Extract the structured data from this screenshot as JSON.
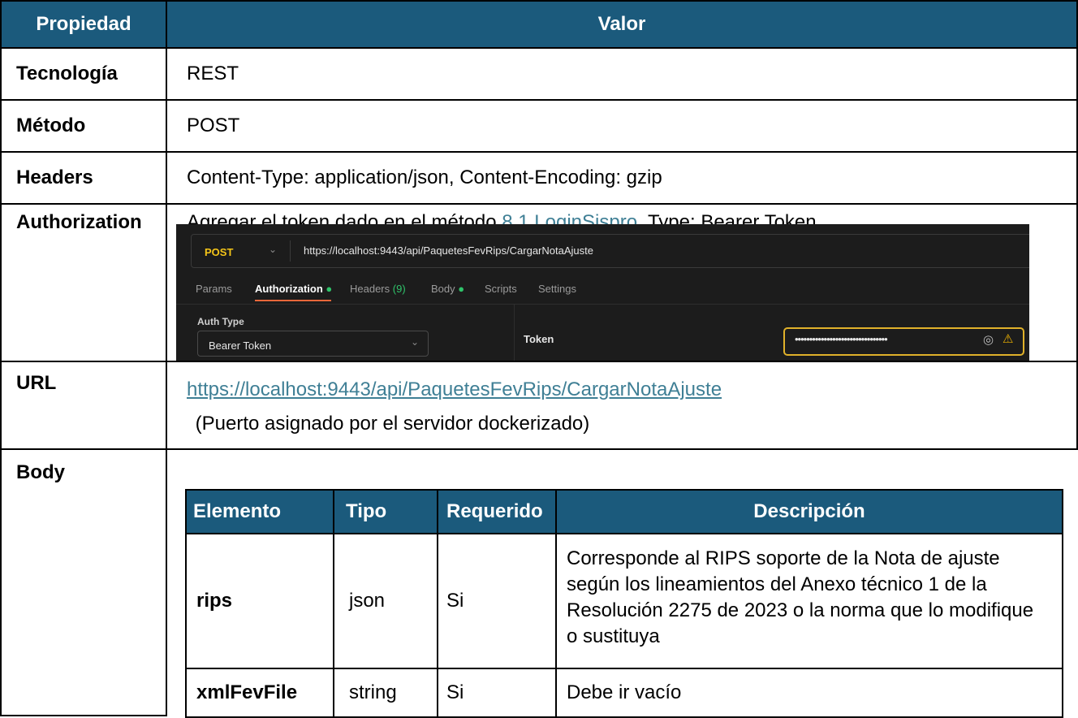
{
  "main_table": {
    "headers": {
      "property": "Propiedad",
      "value": "Valor"
    },
    "rows": {
      "technology": {
        "key": "Tecnología",
        "value": "REST"
      },
      "method": {
        "key": "Método",
        "value": "POST"
      },
      "headers": {
        "key": "Headers",
        "value": "Content-Type: application/json, Content-Encoding: gzip"
      },
      "authorization": {
        "key": "Authorization",
        "text_before": "Agregar el token dado en el método ",
        "link": "8.1 LoginSispro",
        "text_after": ", Type: Bearer Token"
      },
      "url": {
        "key": "URL",
        "link": "https://localhost:9443/api/PaquetesFevRips/CargarNotaAjuste",
        "note": " (Puerto asignado por el servidor dockerizado)"
      },
      "body": {
        "key": "Body"
      }
    }
  },
  "postman": {
    "method": "POST",
    "url": "https://localhost:9443/api/PaquetesFevRips/CargarNotaAjuste",
    "tabs": [
      {
        "label": "Params"
      },
      {
        "label": "Authorization",
        "dot": true,
        "active": true
      },
      {
        "label": "Headers",
        "count": "(9)"
      },
      {
        "label": "Body",
        "dot": true
      },
      {
        "label": "Scripts"
      },
      {
        "label": "Settings"
      }
    ],
    "auth_type_label": "Auth Type",
    "auth_type_value": "Bearer Token",
    "token_label": "Token",
    "token_value": "••••••••••••••••••••••••••••••••",
    "colors": {
      "method": "#f5c518",
      "dot": "#2fc36a",
      "count": "#2fc36a",
      "token_border": "#e0b12a",
      "active_underline": "#e8673a"
    }
  },
  "body_table": {
    "headers": {
      "element": "Elemento",
      "type": "Tipo",
      "required": "Requerido",
      "description": "Descripción"
    },
    "rows": [
      {
        "element": "rips",
        "type": "json",
        "required": "Si",
        "description": "Corresponde al RIPS soporte de la Nota de ajuste según los lineamientos del Anexo técnico 1 de la Resolución 2275 de 2023 o la norma que lo modifique o sustituya"
      },
      {
        "element": "xmlFevFile",
        "type": "string",
        "required": "Si",
        "description": "Debe ir vacío"
      }
    ]
  },
  "colors": {
    "header_bg": "#1b5a7c",
    "link": "#3f7f95"
  }
}
